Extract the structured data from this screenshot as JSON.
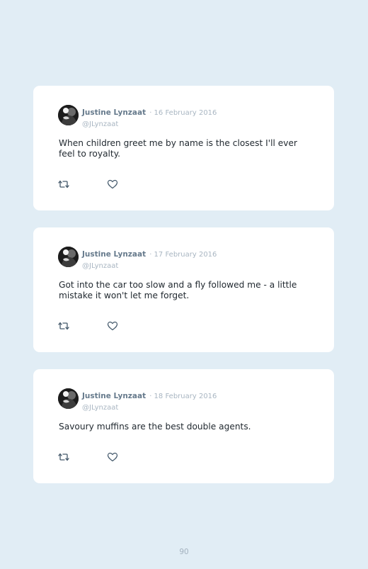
{
  "tweets": [
    {
      "name": "Justine Lynzaat",
      "date": "· 16 February 2016",
      "handle": "@JLynzaat",
      "text": "When children greet me by name is the closest I'll ever feel to royalty."
    },
    {
      "name": "Justine Lynzaat",
      "date": "· 17 February 2016",
      "handle": "@JLynzaat",
      "text": "Got into the car too slow and a fly followed me - a little mistake it won't let me forget."
    },
    {
      "name": "Justine Lynzaat",
      "date": "· 18 February 2016",
      "handle": "@JLynzaat",
      "text": "Savoury muffins are the best double agents."
    }
  ],
  "icons": {
    "retweet": "retweet-icon",
    "like": "heart-icon"
  },
  "colors": {
    "background": "#e1edf5",
    "card": "#ffffff",
    "name": "#667a8c",
    "muted": "#a9b6c2",
    "text": "#222a31",
    "icon": "#44596b"
  },
  "page": {
    "number": "90"
  }
}
